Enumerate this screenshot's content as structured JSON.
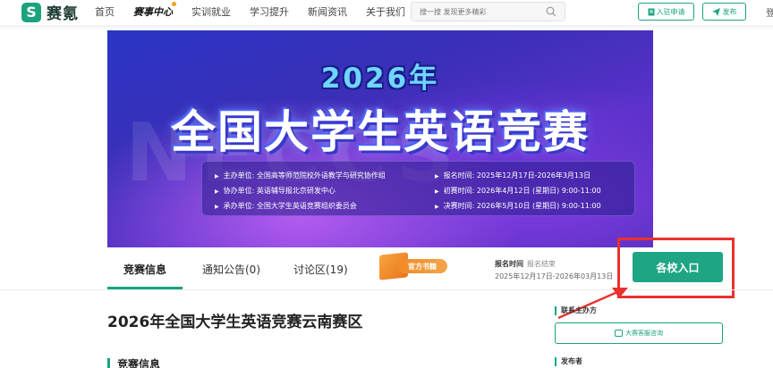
{
  "nav": {
    "logo_mark": "S",
    "logo_text": "赛氪",
    "items": [
      "首页",
      "赛事中心",
      "实训就业",
      "学习提升",
      "新闻资讯",
      "关于我们"
    ],
    "active_item": "赛事中心",
    "search_placeholder": "搜一搜 发现更多精彩",
    "apply_label": "入驻申请",
    "publish_label": "发布",
    "cut_text": "登"
  },
  "banner": {
    "year": "2026年",
    "title": "全国大学生英语竞赛",
    "ghost_text": "NECCS",
    "info_left": [
      "主办单位: 全国高等师范院校外语教学与研究协作组",
      "协办单位: 英语辅导报北京研发中心",
      "承办单位: 全国大学生英语竞赛组织委员会"
    ],
    "info_right": [
      "报名时间: 2025年12月17日-2026年3月13日",
      "初赛时间: 2026年4月12日 (星期日) 9:00-11:00",
      "决赛时间: 2026年5月10日 (星期日) 9:00-11:00"
    ]
  },
  "tabs": [
    {
      "label": "竞赛信息"
    },
    {
      "label": "通知公告(0)"
    },
    {
      "label": "讨论区(19)"
    }
  ],
  "book_badge": "官方书籍",
  "registration": {
    "label": "报名时间",
    "status": "报名结束",
    "range": "2025年12月17日-2026年03月13日"
  },
  "entry_button": "各校入口",
  "content": {
    "title": "2026年全国大学生英语竞赛云南赛区",
    "section_heading": "竞赛信息"
  },
  "sidebar": {
    "contact_heading": "联系主办方",
    "contact_button": "大赛客服咨询",
    "publisher_heading": "发布者"
  },
  "colors": {
    "brand": "#1aa37e",
    "highlight": "#e8322d",
    "entry_button": "#1fa584"
  }
}
